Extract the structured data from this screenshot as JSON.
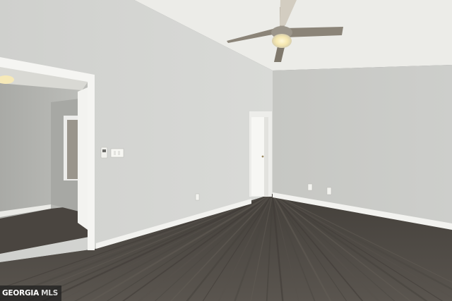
{
  "photo": {
    "subject": "empty-bedroom",
    "colors": {
      "wall_left": "#d2d3d0",
      "wall_right": "#c9cac6",
      "ceiling": "#eeeeea",
      "trim": "#f4f4f1",
      "floor": "#4e4a45",
      "hallway": "#b4b5b1"
    },
    "icons": [
      "ceiling-fan-icon",
      "thermostat-icon",
      "light-switch-icon",
      "outlet-icon"
    ]
  },
  "watermark": {
    "brand_part1": "GEORGIA",
    "brand_part2": "MLS"
  }
}
